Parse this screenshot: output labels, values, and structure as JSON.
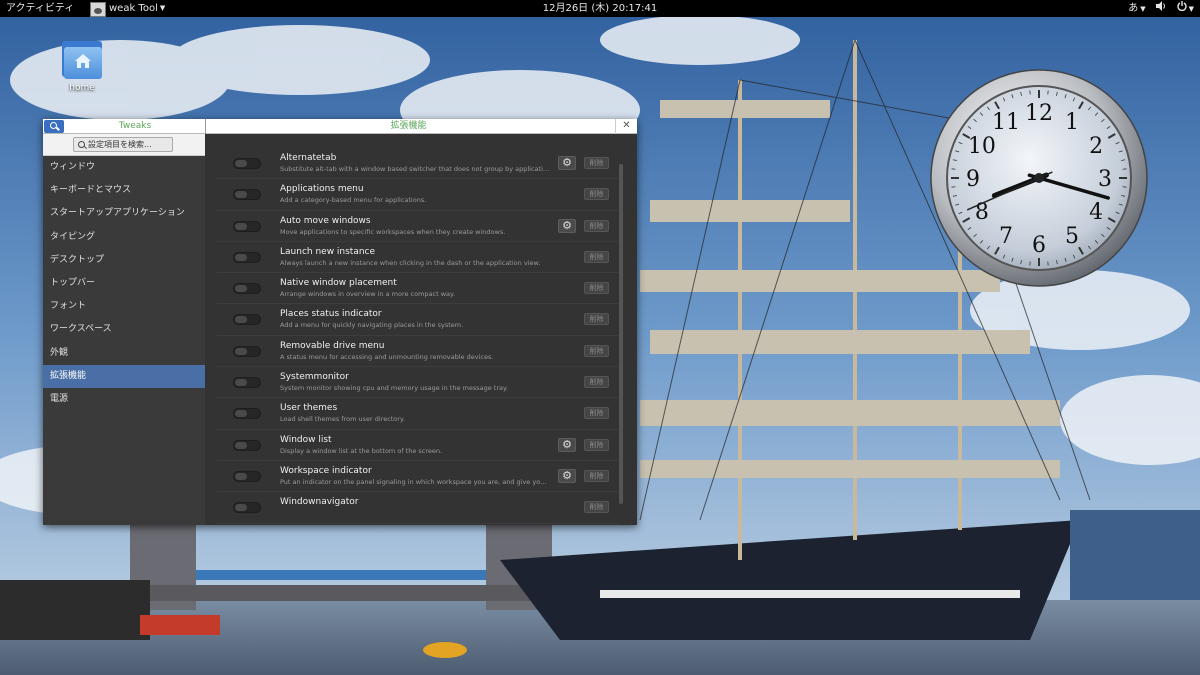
{
  "topbar": {
    "activities_label": "アクティビティ",
    "app_menu_label": "weak Tool",
    "datetime": "12月26日 (木) 20:17:41",
    "input_method": "あ"
  },
  "desktop": {
    "home_icon_label": "home"
  },
  "clock_widget": {
    "numerals": [
      "12",
      "1",
      "2",
      "3",
      "4",
      "5",
      "6",
      "7",
      "8",
      "9",
      "10",
      "11"
    ],
    "time": {
      "hours": 20,
      "minutes": 17,
      "seconds": 41
    }
  },
  "window": {
    "sidebar_title": "Tweaks",
    "main_title": "拡張機能",
    "search_placeholder": "設定項目を検索...",
    "sidebar_items": [
      {
        "label": "ウィンドウ",
        "active": false
      },
      {
        "label": "キーボードとマウス",
        "active": false
      },
      {
        "label": "スタートアップアプリケーション",
        "active": false
      },
      {
        "label": "タイピング",
        "active": false
      },
      {
        "label": "デスクトップ",
        "active": false
      },
      {
        "label": "トップバー",
        "active": false
      },
      {
        "label": "フォント",
        "active": false
      },
      {
        "label": "ワークスペース",
        "active": false
      },
      {
        "label": "外観",
        "active": false
      },
      {
        "label": "拡張機能",
        "active": true
      },
      {
        "label": "電源",
        "active": false
      }
    ],
    "remove_label": "削除",
    "extensions": [
      {
        "name": "Alternatetab",
        "description": "Substitute alt-tab with a window based switcher that does not group by application.",
        "has_settings": true
      },
      {
        "name": "Applications menu",
        "description": "Add a category-based menu for applications.",
        "has_settings": false
      },
      {
        "name": "Auto move windows",
        "description": "Move applications to specific workspaces when they create windows.",
        "has_settings": true
      },
      {
        "name": "Launch new instance",
        "description": "Always launch a new instance when clicking in the dash or the application view.",
        "has_settings": false
      },
      {
        "name": "Native window placement",
        "description": "Arrange windows in overview in a more compact way.",
        "has_settings": false
      },
      {
        "name": "Places status indicator",
        "description": "Add a menu for quickly navigating places in the system.",
        "has_settings": false
      },
      {
        "name": "Removable drive menu",
        "description": "A status menu for accessing and unmounting removable devices.",
        "has_settings": false
      },
      {
        "name": "Systemmonitor",
        "description": "System monitor showing cpu and memory usage in the message tray.",
        "has_settings": false
      },
      {
        "name": "User themes",
        "description": "Load shell themes from user directory.",
        "has_settings": false
      },
      {
        "name": "Window list",
        "description": "Display a window list at the bottom of the screen.",
        "has_settings": true
      },
      {
        "name": "Workspace indicator",
        "description": "Put an indicator on the panel signaling in which workspace you are, and give you the possibility of switching to another one.",
        "has_settings": true
      },
      {
        "name": "Windownavigator",
        "description": "",
        "has_settings": false
      }
    ]
  }
}
